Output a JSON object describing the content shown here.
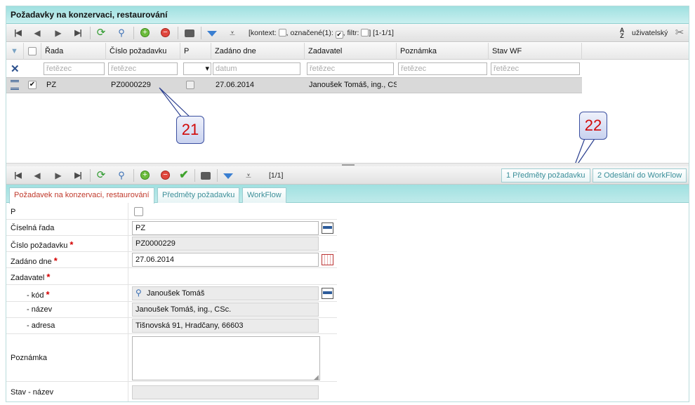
{
  "panel": {
    "title": "Požadavky na konzervaci, restaurování"
  },
  "top_toolbar": {
    "context_prefix": "[kontext:",
    "context_marked": ", označené(1):",
    "context_filter": ", filtr:",
    "context_suffix": "] [1-1/1]",
    "sort_label": "uživatelský"
  },
  "grid": {
    "columns": [
      "Řada",
      "Číslo požadavku",
      "P",
      "Zadáno dne",
      "Zadavatel",
      "Poznámka",
      "Stav WF"
    ],
    "filters": {
      "rada": "řetězec",
      "cislo": "řetězec",
      "zadano": "datum",
      "zadavatel": "řetězec",
      "poznamka": "řetězec",
      "stav": "řetězec"
    },
    "rows": [
      {
        "rada": "PZ",
        "cislo": "PZ0000229",
        "zadano": "27.06.2014",
        "zadavatel": "Janoušek Tomáš, ing., CS"
      }
    ]
  },
  "callouts": {
    "c21": "21",
    "c22": "22"
  },
  "bottom_toolbar": {
    "counter": "[1/1]",
    "btn_predmety": "1 Předměty požadavku",
    "btn_odeslani": "2 Odeslání do WorkFlow"
  },
  "tabs": [
    "Požadavek na konzervaci, restaurování",
    "Předměty požadavku",
    "WorkFlow"
  ],
  "form": {
    "p_label": "P",
    "rada_label": "Číselná řada",
    "rada_value": "PZ",
    "cislo_label": "Číslo požadavku",
    "cislo_value": "PZ0000229",
    "zadano_label": "Zadáno dne",
    "zadano_value": "27.06.2014",
    "zadavatel_label": "Zadavatel",
    "kod_label": "- kód",
    "kod_value": "Janoušek Tomáš",
    "nazev_label": "- název",
    "nazev_value": "Janoušek Tomáš, ing., CSc.",
    "adresa_label": "- adresa",
    "adresa_value": "Tišnovská 91, Hradčany, 66603",
    "poznamka_label": "Poznámka",
    "poznamka_value": "",
    "stav_label": "Stav - název",
    "stav_value": ""
  },
  "colors": {
    "accent": "#a6e3e3",
    "tab_active_text": "#c0392b",
    "callout_text": "#d10a0a"
  }
}
